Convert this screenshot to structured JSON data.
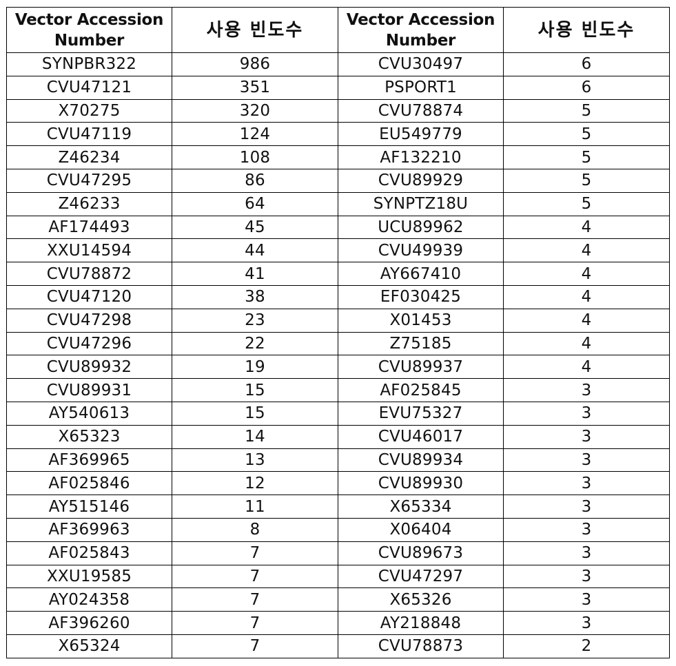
{
  "table": {
    "headers": [
      {
        "line1": "Vector Accession",
        "line2": "Number"
      },
      {
        "text": "사용 빈도수"
      },
      {
        "line1": "Vector Accession",
        "line2": "Number"
      },
      {
        "text": "사용 빈도수"
      }
    ],
    "left_rows": [
      {
        "accession": "SYNPBR322",
        "frequency": "986"
      },
      {
        "accession": "CVU47121",
        "frequency": "351"
      },
      {
        "accession": "X70275",
        "frequency": "320"
      },
      {
        "accession": "CVU47119",
        "frequency": "124"
      },
      {
        "accession": "Z46234",
        "frequency": "108"
      },
      {
        "accession": "CVU47295",
        "frequency": "86"
      },
      {
        "accession": "Z46233",
        "frequency": "64"
      },
      {
        "accession": "AF174493",
        "frequency": "45"
      },
      {
        "accession": "XXU14594",
        "frequency": "44"
      },
      {
        "accession": "CVU78872",
        "frequency": "41"
      },
      {
        "accession": "CVU47120",
        "frequency": "38"
      },
      {
        "accession": "CVU47298",
        "frequency": "23"
      },
      {
        "accession": "CVU47296",
        "frequency": "22"
      },
      {
        "accession": "CVU89932",
        "frequency": "19"
      },
      {
        "accession": "CVU89931",
        "frequency": "15"
      },
      {
        "accession": "AY540613",
        "frequency": "15"
      },
      {
        "accession": "X65323",
        "frequency": "14"
      },
      {
        "accession": "AF369965",
        "frequency": "13"
      },
      {
        "accession": "AF025846",
        "frequency": "12"
      },
      {
        "accession": "AY515146",
        "frequency": "11"
      },
      {
        "accession": "AF369963",
        "frequency": "8"
      },
      {
        "accession": "AF025843",
        "frequency": "7"
      },
      {
        "accession": "XXU19585",
        "frequency": "7"
      },
      {
        "accession": "AY024358",
        "frequency": "7"
      },
      {
        "accession": "AF396260",
        "frequency": "7"
      },
      {
        "accession": "X65324",
        "frequency": "7"
      }
    ],
    "right_rows": [
      {
        "accession": "CVU30497",
        "frequency": "6"
      },
      {
        "accession": "PSPORT1",
        "frequency": "6"
      },
      {
        "accession": "CVU78874",
        "frequency": "5"
      },
      {
        "accession": "EU549779",
        "frequency": "5"
      },
      {
        "accession": "AF132210",
        "frequency": "5"
      },
      {
        "accession": "CVU89929",
        "frequency": "5"
      },
      {
        "accession": "SYNPTZ18U",
        "frequency": "5"
      },
      {
        "accession": "UCU89962",
        "frequency": "4"
      },
      {
        "accession": "CVU49939",
        "frequency": "4"
      },
      {
        "accession": "AY667410",
        "frequency": "4"
      },
      {
        "accession": "EF030425",
        "frequency": "4"
      },
      {
        "accession": "X01453",
        "frequency": "4"
      },
      {
        "accession": "Z75185",
        "frequency": "4"
      },
      {
        "accession": "CVU89937",
        "frequency": "4"
      },
      {
        "accession": "AF025845",
        "frequency": "3"
      },
      {
        "accession": "EVU75327",
        "frequency": "3"
      },
      {
        "accession": "CVU46017",
        "frequency": "3"
      },
      {
        "accession": "CVU89934",
        "frequency": "3"
      },
      {
        "accession": "CVU89930",
        "frequency": "3"
      },
      {
        "accession": "X65334",
        "frequency": "3"
      },
      {
        "accession": "X06404",
        "frequency": "3"
      },
      {
        "accession": "CVU89673",
        "frequency": "3"
      },
      {
        "accession": "CVU47297",
        "frequency": "3"
      },
      {
        "accession": "X65326",
        "frequency": "3"
      },
      {
        "accession": "AY218848",
        "frequency": "3"
      },
      {
        "accession": "CVU78873",
        "frequency": "2"
      }
    ]
  }
}
